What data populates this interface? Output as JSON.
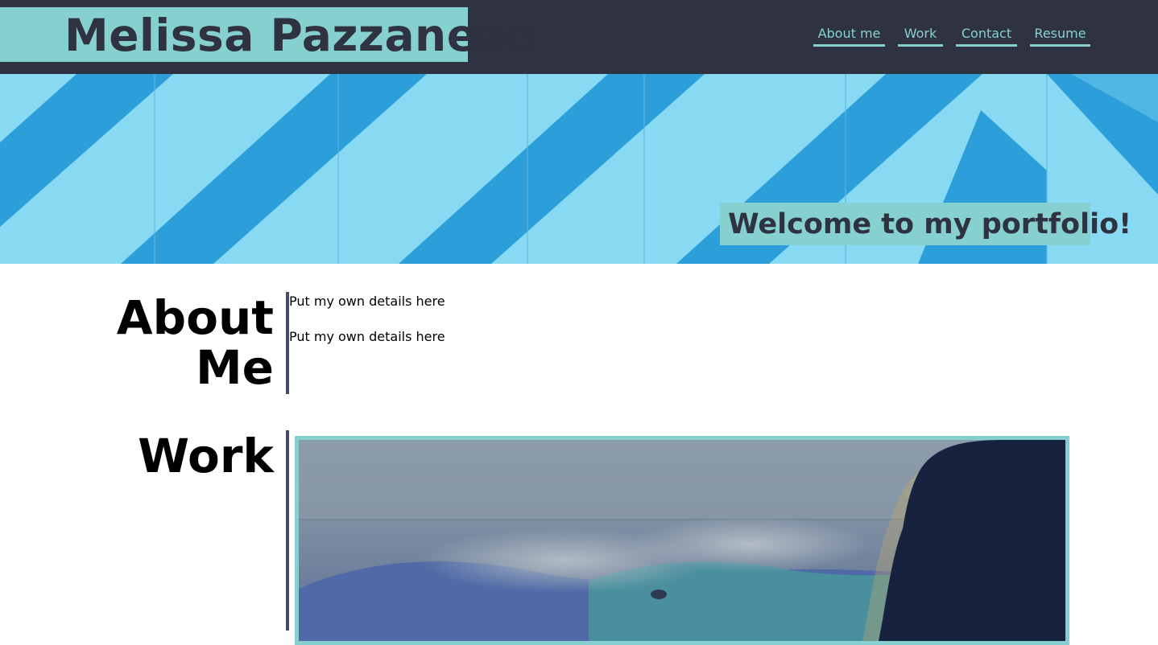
{
  "header": {
    "brand_name": "Melissa Pazzanese",
    "nav": [
      {
        "label": "About me"
      },
      {
        "label": "Work"
      },
      {
        "label": "Contact"
      },
      {
        "label": "Resume"
      }
    ]
  },
  "hero": {
    "welcome": "Welcome to my portfolio!"
  },
  "about": {
    "heading_line1": "About",
    "heading_line2": "Me",
    "paragraphs": [
      "Put my own details here",
      "Put my own details here"
    ]
  },
  "work": {
    "heading": "Work"
  },
  "colors": {
    "header_bg": "#2f3240",
    "accent_teal": "#86d0cf",
    "hero_light_blue": "#88daf3",
    "hero_stripe_blue": "#2c9fdb",
    "divider": "#444c68"
  }
}
